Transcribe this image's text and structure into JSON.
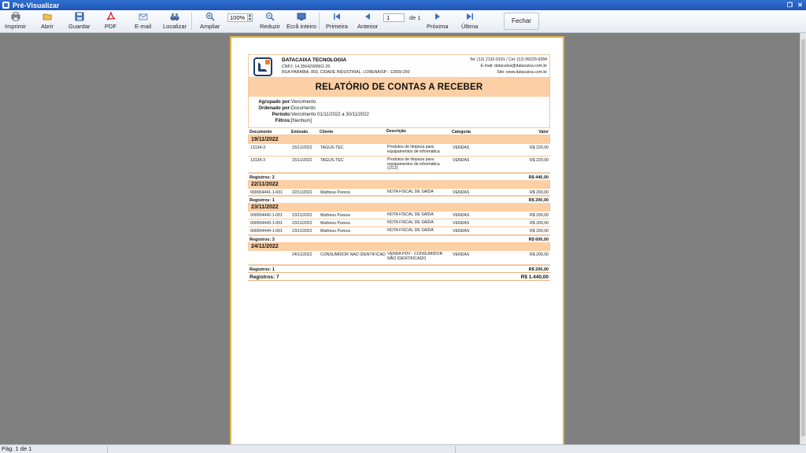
{
  "window": {
    "title": "Pré-Visualizar"
  },
  "toolbar": {
    "buttons": {
      "print": "Imprimir",
      "open": "Abrir",
      "save": "Guardar",
      "pdf": "PDF",
      "email": "E-mail",
      "find": "Localizar",
      "zoom_in": "Ampliar",
      "zoom_out": "Reduzir",
      "fullscreen": "Ecrã inteiro",
      "first": "Primeira",
      "previous": "Anterior",
      "next": "Próxima",
      "last": "Última",
      "close": "Fechar"
    },
    "zoom_value": "100%",
    "page_value": "1",
    "page_of": "de 1"
  },
  "report": {
    "company": {
      "name": "DATACAIXA TECNOLOGIA",
      "cnpj": "CNPJ: 14.356429/0001-20",
      "address": "RUA PARAÍBA, 893, CIDADE INDUSTRIAL, LORENA/SP - 12609-250",
      "phone": "Tel: (12) 2132-0191 / Cel: (12) 99229-9284",
      "email": "E-mail: datacaixa@datacaixa.com.br",
      "site": "Site: www.datacaixa.com.br"
    },
    "title": "RELATÓRIO DE CONTAS A RECEBER",
    "filters": [
      {
        "label": "Agrupado por:",
        "value": "Vencimento"
      },
      {
        "label": "Ordenado por:",
        "value": "Documento"
      },
      {
        "label": "Período:",
        "value": "Vencimento 01/11/2022 a 30/11/2022"
      },
      {
        "label": "Filtros:",
        "value": "[Nenhum]"
      }
    ],
    "columns": {
      "doc": "Documento",
      "emission": "Emissão",
      "client": "Cliente",
      "description": "Descrição",
      "category": "Categoria",
      "value": "Valor"
    },
    "groups": [
      {
        "date": "19/11/2022",
        "rows": [
          {
            "doc": "13134-3",
            "emission": "15/11/2022",
            "client": "TAGUS-TEC",
            "description": "Produtos de limpeza para equipamentos de informática",
            "category": "VENDAS",
            "value": "R$ 220,00"
          },
          {
            "doc": "13134-3",
            "emission": "15/11/2022",
            "client": "TAGUS-TEC",
            "description": "Produtos de limpeza para equipamentos de informática (1/12)",
            "category": "VENDAS",
            "value": "R$ 220,00"
          }
        ],
        "count": "Registros: 2",
        "total": "R$ 440,00"
      },
      {
        "date": "22/11/2022",
        "rows": [
          {
            "doc": "000004441-1-001",
            "emission": "22/11/2022",
            "client": "Matheus Pureza",
            "description": "NOTA FISCAL DE SAÍDA",
            "category": "VENDAS",
            "value": "R$ 200,00"
          }
        ],
        "count": "Registros: 1",
        "total": "R$ 200,00"
      },
      {
        "date": "23/11/2022",
        "rows": [
          {
            "doc": "000004442-1-001",
            "emission": "23/11/2022",
            "client": "Matheus Pureza",
            "description": "NOTA FISCAL DE SAÍDA",
            "category": "VENDAS",
            "value": "R$ 200,00"
          },
          {
            "doc": "000004443-1-001",
            "emission": "23/11/2022",
            "client": "Matheus Pureza",
            "description": "NOTA FISCAL DE SAÍDA",
            "category": "VENDAS",
            "value": "R$ 200,00"
          },
          {
            "doc": "000004444-1-001",
            "emission": "23/11/2022",
            "client": "Matheus Pureza",
            "description": "NOTA FISCAL DE SAÍDA",
            "category": "VENDAS",
            "value": "R$ 200,00"
          }
        ],
        "count": "Registros: 3",
        "total": "R$ 600,00"
      },
      {
        "date": "24/11/2022",
        "rows": [
          {
            "doc": "",
            "emission": "24/11/2022",
            "client": "CONSUMIDOR NÃO IDENTIFICAD",
            "description": "VENDA PDV - CONSUMIDOR NÃO IDENTIFICADO",
            "category": "VENDAS",
            "value": "R$ 200,00"
          }
        ],
        "count": "Registros: 1",
        "total": "R$ 200,00"
      }
    ],
    "grand_count": "Registros: 7",
    "grand_total": "R$ 1.440,00"
  },
  "status": {
    "page": "Pág. 1 de 1"
  }
}
